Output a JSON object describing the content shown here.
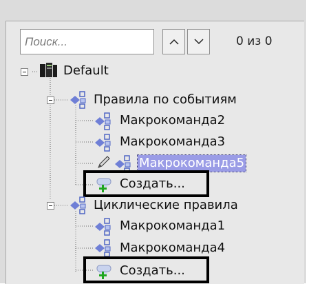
{
  "search": {
    "placeholder": "Поиск...",
    "value": ""
  },
  "nav": {
    "prev_icon": "chevron-up-icon",
    "next_icon": "chevron-down-icon"
  },
  "counter": "0 из 0",
  "tree": {
    "root": {
      "label": "Default",
      "icon": "server-icon"
    },
    "groups": [
      {
        "label": "Правила по событиям",
        "icon": "rule-group-icon",
        "items": [
          {
            "label": "Макрокоманда2",
            "icon": "macro-icon"
          },
          {
            "label": "Макрокоманда3",
            "icon": "macro-icon"
          },
          {
            "label": "Макрокоманда5",
            "icon": "macro-icon",
            "selected": true,
            "edit_icon": "pencil-icon"
          }
        ],
        "create": {
          "label": "Создать...",
          "icon": "create-macro-icon"
        }
      },
      {
        "label": "Циклические правила",
        "icon": "rule-group-icon",
        "items": [
          {
            "label": "Макрокоманда1",
            "icon": "macro-icon"
          },
          {
            "label": "Макрокоманда4",
            "icon": "macro-icon"
          }
        ],
        "create": {
          "label": "Создать...",
          "icon": "create-macro-icon"
        }
      }
    ]
  },
  "colors": {
    "selection": "#9a9ce6",
    "macro_icon": "#6f7fd6",
    "plus": "#1fa51f",
    "highlight_box": "#000000"
  }
}
